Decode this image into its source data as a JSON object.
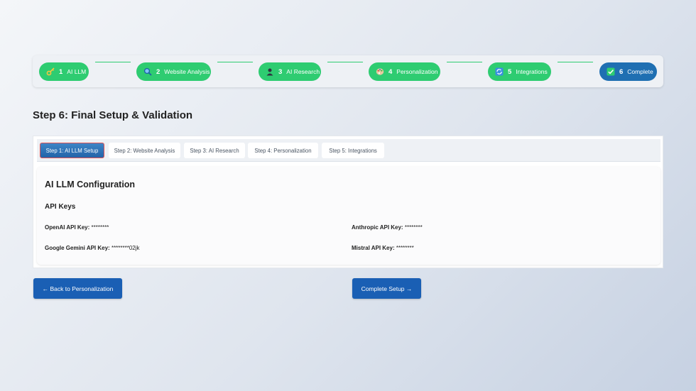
{
  "stepper": {
    "steps": [
      {
        "num": "1",
        "label": "AI LLM",
        "icon": "key-icon"
      },
      {
        "num": "2",
        "label": "Website Analysis",
        "icon": "magnifier-icon"
      },
      {
        "num": "3",
        "label": "AI Research",
        "icon": "person-icon"
      },
      {
        "num": "4",
        "label": "Personalization",
        "icon": "palette-icon"
      },
      {
        "num": "5",
        "label": "Integrations",
        "icon": "sync-icon"
      },
      {
        "num": "6",
        "label": "Complete",
        "icon": "checkmark-icon"
      }
    ],
    "active_index": 5,
    "colors": {
      "done": "#2ecc71",
      "active": "#1f6fb2"
    }
  },
  "page_title": "Step 6: Final Setup & Validation",
  "tabs": [
    {
      "label": "Step 1: AI LLM Setup",
      "active": true
    },
    {
      "label": "Step 2: Website Analysis",
      "active": false
    },
    {
      "label": "Step 3: AI Research",
      "active": false
    },
    {
      "label": "Step 4: Personalization",
      "active": false
    },
    {
      "label": "Step 5: Integrations",
      "active": false
    }
  ],
  "config": {
    "title": "AI LLM Configuration",
    "section": "API Keys",
    "keys": [
      {
        "label": "OpenAI API Key:",
        "value": "********"
      },
      {
        "label": "Anthropic API Key:",
        "value": "********"
      },
      {
        "label": "Google Gemini API Key:",
        "value": "********02jk"
      },
      {
        "label": "Mistral API Key:",
        "value": "********"
      }
    ]
  },
  "buttons": {
    "back": "← Back to Personalization",
    "complete": "Complete Setup →"
  }
}
